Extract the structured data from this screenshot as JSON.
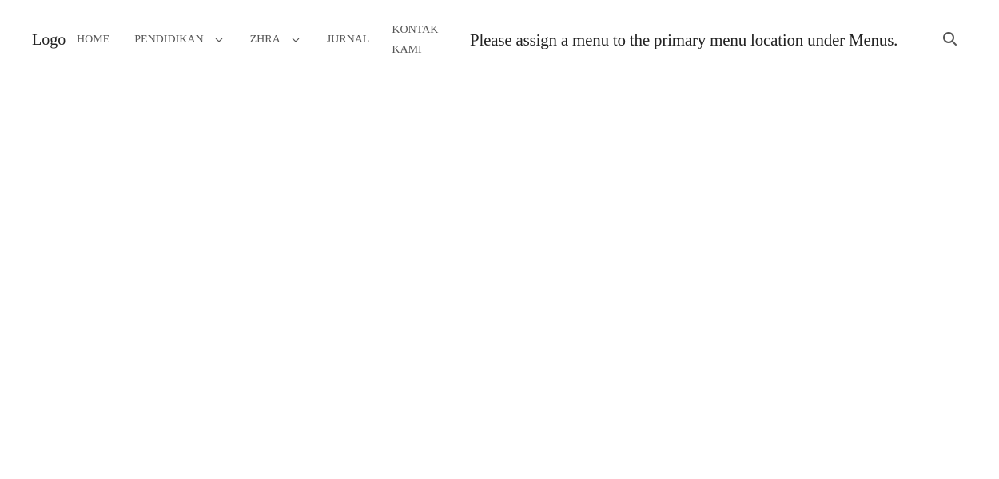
{
  "header": {
    "logo": "Logo",
    "nav": {
      "home": "HOME",
      "pendidikan": "PENDIDIKAN",
      "zhra": "ZHRA",
      "jurnal": "JURNAL",
      "kontak_line1": "KONTAK",
      "kontak_line2": "KAMI"
    },
    "primary_menu_notice": "Please assign a menu to the primary menu location under Menus.",
    "search_icon": "search-icon"
  },
  "colors": {
    "text": "#222222",
    "nav_text": "#555555",
    "background": "#ffffff"
  }
}
